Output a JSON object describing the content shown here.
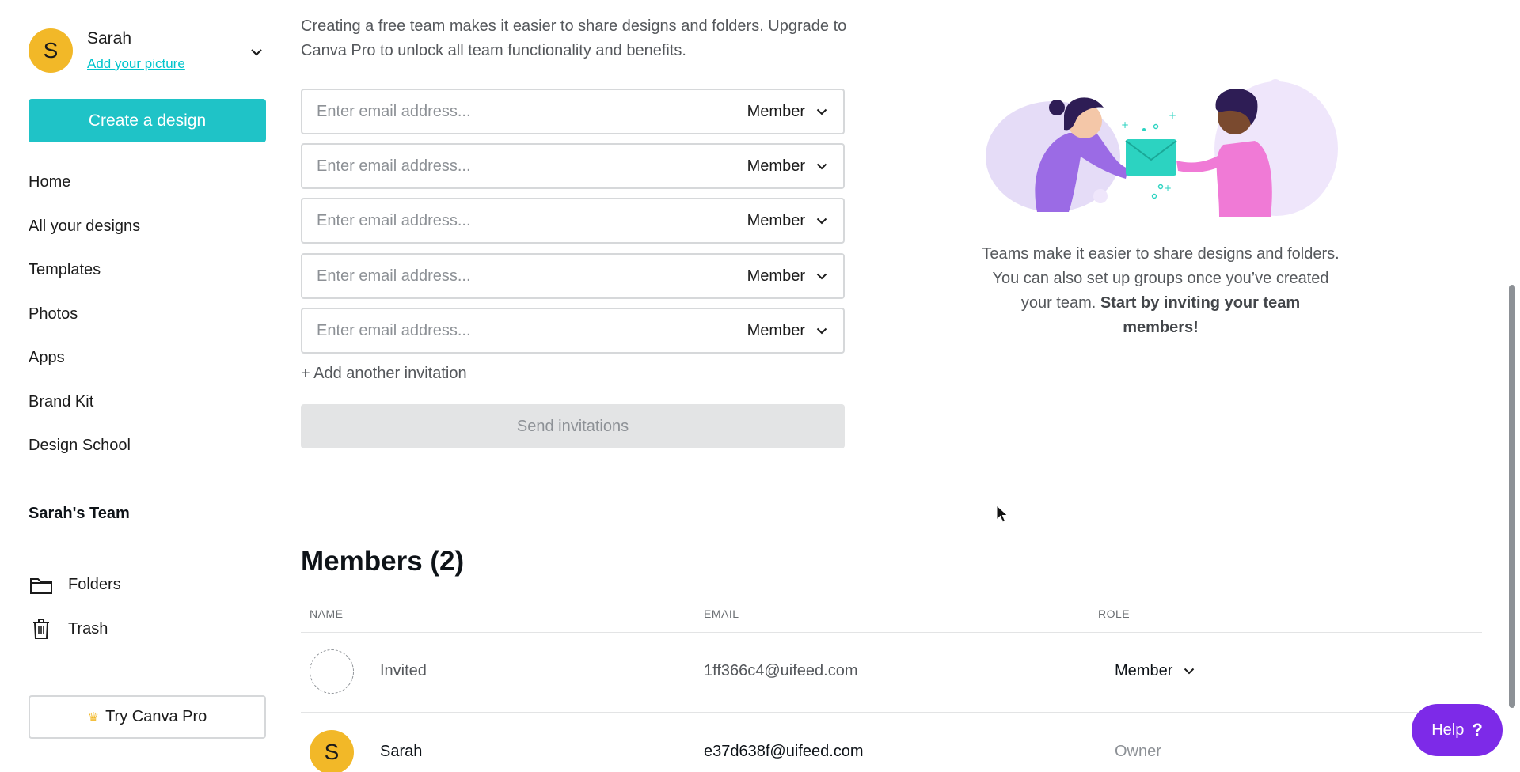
{
  "sidebar": {
    "user": {
      "initial": "S",
      "name": "Sarah",
      "add_picture": "Add your picture"
    },
    "create_label": "Create a design",
    "nav": [
      "Home",
      "All your designs",
      "Templates",
      "Photos",
      "Apps",
      "Brand Kit",
      "Design School"
    ],
    "team_name": "Sarah's Team",
    "team_nav": [
      {
        "label": "Folders",
        "icon": "folder-icon"
      },
      {
        "label": "Trash",
        "icon": "trash-icon"
      }
    ],
    "try_pro": "Try Canva Pro"
  },
  "main": {
    "intro": "Creating a free team makes it easier to share designs and folders. Upgrade to Canva Pro to unlock all team functionality and benefits.",
    "invites": {
      "placeholder": "Enter email address...",
      "role": "Member",
      "count": 5
    },
    "add_invite": "+ Add another invitation",
    "send_label": "Send invitations",
    "illustration": {
      "text": "Teams make it easier to share designs and folders. You can also set up groups once you’ve created your team.",
      "bold": "Start by inviting your team members!"
    },
    "members": {
      "title": "Members (2)",
      "headers": {
        "name": "NAME",
        "email": "EMAIL",
        "role": "ROLE"
      },
      "rows": [
        {
          "name": "Invited",
          "email": "1ff366c4@uifeed.com",
          "role": "Member",
          "status": "invited"
        },
        {
          "name": "Sarah",
          "email": "e37d638f@uifeed.com",
          "role": "Owner",
          "initial": "S",
          "status": "owner"
        }
      ]
    }
  },
  "help": {
    "label": "Help",
    "symbol": "?"
  },
  "colors": {
    "accent": "#1fc3c7",
    "help": "#7d2ae8",
    "avatar": "#f2b828"
  }
}
